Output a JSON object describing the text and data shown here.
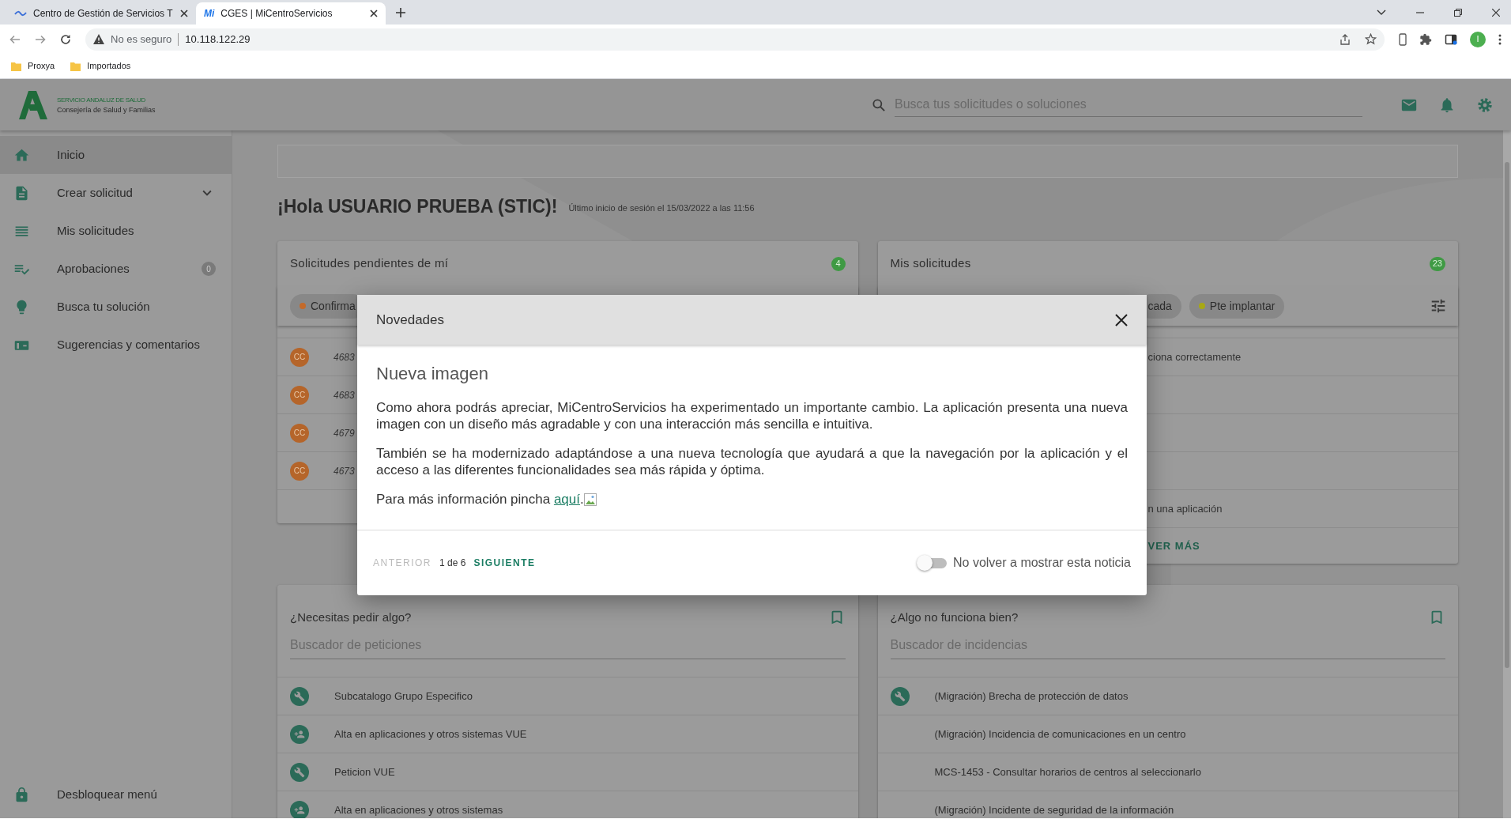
{
  "browser": {
    "tabs": [
      {
        "title": "Centro de Gestión de Servicios T",
        "selected": false
      },
      {
        "title": "CGES | MiCentroServicios",
        "favicon": "Mi",
        "selected": true
      }
    ],
    "security": "No es seguro",
    "url": "10.118.122.29",
    "profile": "I",
    "bookmarks": [
      {
        "label": "Proxya"
      },
      {
        "label": "Importados"
      }
    ]
  },
  "header": {
    "logo_lines": [
      "SERVICIO ANDALUZ DE SALUD",
      "Consejería de Salud y Familias"
    ],
    "search_placeholder": "Busca tus solicitudes o soluciones"
  },
  "sidebar": {
    "items": [
      {
        "label": "Inicio",
        "selected": true
      },
      {
        "label": "Crear solicitud",
        "selected": false,
        "expanded": false
      },
      {
        "label": "Mis solicitudes",
        "selected": false
      },
      {
        "label": "Aprobaciones",
        "selected": false,
        "badge": "0"
      },
      {
        "label": "Busca tu solución",
        "selected": false
      },
      {
        "label": "Sugerencias y comentarios",
        "selected": false
      }
    ],
    "footer": "Desbloquear menú"
  },
  "greeting": {
    "title": "¡Hola USUARIO PRUEBA (STIC)!",
    "last_login": "Último inicio de sesión el 15/03/2022 a las 11:56"
  },
  "pending": {
    "title": "Solicitudes pendientes de mí",
    "count": "4",
    "chips": [
      {
        "label": "Confirma",
        "color": "#c46a2a"
      }
    ],
    "rows": [
      {
        "avatar": "CC",
        "number": "4683"
      },
      {
        "avatar": "CC",
        "number": "4683"
      },
      {
        "avatar": "CC",
        "number": "4679"
      },
      {
        "avatar": "CC",
        "number": "4673"
      }
    ]
  },
  "mine": {
    "title": "Mis solicitudes",
    "count": "23",
    "chips": [
      {
        "label": "cada"
      },
      {
        "label": "Pte implantar",
        "color": "#a8a814"
      }
    ],
    "rows": [
      {
        "text": "ciona correctamente"
      },
      {
        "text": "n una aplicación"
      }
    ],
    "more": "VER MÁS"
  },
  "requests": [
    {
      "title": "¿Necesitas pedir algo?",
      "placeholder": "Buscador de peticiones",
      "rows": [
        {
          "kind": "wrench",
          "label": "Subcatalogo Grupo Especifico"
        },
        {
          "kind": "person-add",
          "label": "Alta en aplicaciones y otros sistemas VUE"
        },
        {
          "kind": "wrench",
          "label": "Peticion VUE"
        },
        {
          "kind": "person-add",
          "label": "Alta en aplicaciones y otros sistemas"
        }
      ]
    },
    {
      "title": "¿Algo no funciona bien?",
      "placeholder": "Buscador de incidencias",
      "rows": [
        {
          "kind": "wrench",
          "label": "(Migración) Brecha de protección de datos"
        },
        {
          "kind": "plain",
          "label": "(Migración) Incidencia de comunicaciones en un centro"
        },
        {
          "kind": "plain",
          "label": "MCS-1453 - Consultar horarios de centros al seleccionarlo"
        },
        {
          "kind": "plain",
          "label": "(Migración) Incidente de seguridad de la información"
        }
      ]
    }
  ],
  "modal": {
    "title": "Novedades",
    "heading": "Nueva imagen",
    "paragraphs": [
      "Como ahora podrás apreciar, MiCentroServicios ha experimentado un importante cambio. La aplicación presenta una nueva imagen con un diseño más agradable y con una interacción más sencilla e intuitiva.",
      "También se ha modernizado adaptándose a una nueva tecnología que ayudará a que la navegación por la aplicación y el acceso a las diferentes funcionalidades sea más rápida y óptima."
    ],
    "more_text": "Para más información pincha ",
    "link": "aquí",
    "link_after": ".",
    "prev": {
      "label": "ANTERIOR",
      "disabled": true
    },
    "page": "1 de 6",
    "next": {
      "label": "SIGUIENTE",
      "disabled": false
    },
    "toggle": {
      "label": "No volver a mostrar esta noticia",
      "on": false
    }
  }
}
